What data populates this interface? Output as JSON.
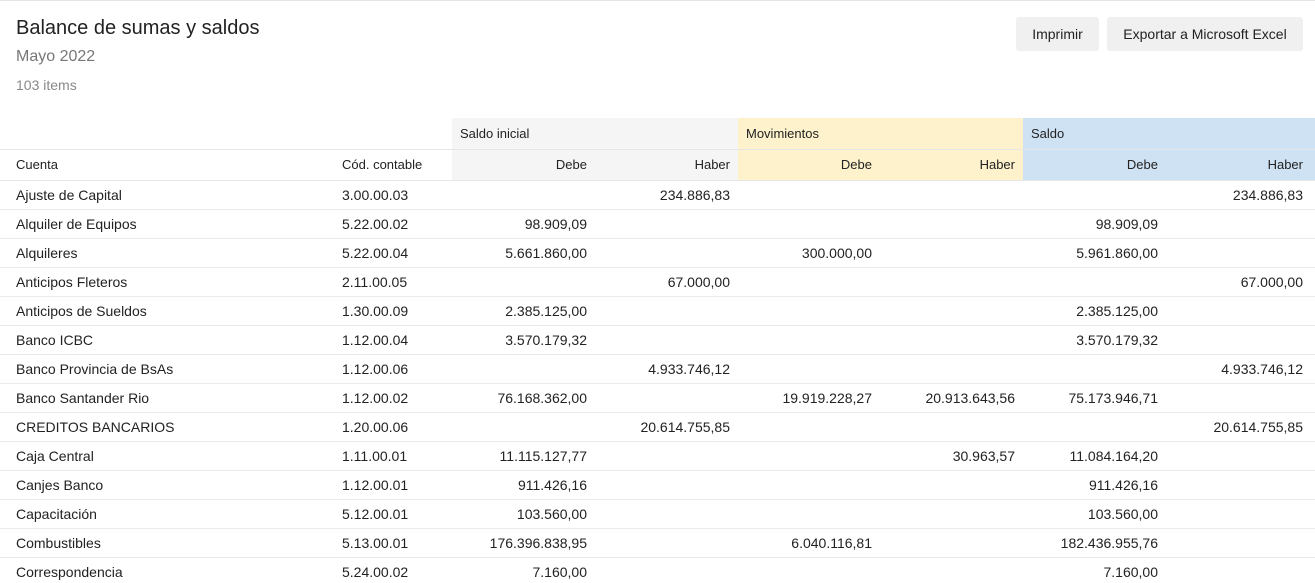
{
  "header": {
    "title": "Balance de sumas y saldos",
    "subtitle": "Mayo 2022",
    "count": "103 items"
  },
  "toolbar": {
    "print_label": "Imprimir",
    "excel_label": "Exportar a Microsoft Excel"
  },
  "table": {
    "groups": {
      "initial": "Saldo inicial",
      "movements": "Movimientos",
      "balance": "Saldo"
    },
    "columns": {
      "account": "Cuenta",
      "code": "Cód. contable",
      "debit": "Debe",
      "credit": "Haber"
    },
    "colors": {
      "initial_bg": "#f5f5f5",
      "movements_bg": "#fdf2cc",
      "balance_bg": "#cfe2f4"
    },
    "rows": [
      {
        "cuenta": "Ajuste de Capital",
        "codigo": "3.00.00.03",
        "si_debe": "",
        "si_haber": "234.886,83",
        "mov_debe": "",
        "mov_haber": "",
        "saldo_debe": "",
        "saldo_haber": "234.886,83"
      },
      {
        "cuenta": "Alquiler de Equipos",
        "codigo": "5.22.00.02",
        "si_debe": "98.909,09",
        "si_haber": "",
        "mov_debe": "",
        "mov_haber": "",
        "saldo_debe": "98.909,09",
        "saldo_haber": ""
      },
      {
        "cuenta": "Alquileres",
        "codigo": "5.22.00.04",
        "si_debe": "5.661.860,00",
        "si_haber": "",
        "mov_debe": "300.000,00",
        "mov_haber": "",
        "saldo_debe": "5.961.860,00",
        "saldo_haber": ""
      },
      {
        "cuenta": "Anticipos Fleteros",
        "codigo": "2.11.00.05",
        "si_debe": "",
        "si_haber": "67.000,00",
        "mov_debe": "",
        "mov_haber": "",
        "saldo_debe": "",
        "saldo_haber": "67.000,00"
      },
      {
        "cuenta": "Anticipos de Sueldos",
        "codigo": "1.30.00.09",
        "si_debe": "2.385.125,00",
        "si_haber": "",
        "mov_debe": "",
        "mov_haber": "",
        "saldo_debe": "2.385.125,00",
        "saldo_haber": ""
      },
      {
        "cuenta": "Banco ICBC",
        "codigo": "1.12.00.04",
        "si_debe": "3.570.179,32",
        "si_haber": "",
        "mov_debe": "",
        "mov_haber": "",
        "saldo_debe": "3.570.179,32",
        "saldo_haber": ""
      },
      {
        "cuenta": "Banco Provincia de BsAs",
        "codigo": "1.12.00.06",
        "si_debe": "",
        "si_haber": "4.933.746,12",
        "mov_debe": "",
        "mov_haber": "",
        "saldo_debe": "",
        "saldo_haber": "4.933.746,12"
      },
      {
        "cuenta": "Banco Santander Rio",
        "codigo": "1.12.00.02",
        "si_debe": "76.168.362,00",
        "si_haber": "",
        "mov_debe": "19.919.228,27",
        "mov_haber": "20.913.643,56",
        "saldo_debe": "75.173.946,71",
        "saldo_haber": ""
      },
      {
        "cuenta": "CREDITOS BANCARIOS",
        "codigo": "1.20.00.06",
        "si_debe": "",
        "si_haber": "20.614.755,85",
        "mov_debe": "",
        "mov_haber": "",
        "saldo_debe": "",
        "saldo_haber": "20.614.755,85"
      },
      {
        "cuenta": "Caja Central",
        "codigo": "1.11.00.01",
        "si_debe": "11.115.127,77",
        "si_haber": "",
        "mov_debe": "",
        "mov_haber": "30.963,57",
        "saldo_debe": "11.084.164,20",
        "saldo_haber": ""
      },
      {
        "cuenta": "Canjes Banco",
        "codigo": "1.12.00.01",
        "si_debe": "911.426,16",
        "si_haber": "",
        "mov_debe": "",
        "mov_haber": "",
        "saldo_debe": "911.426,16",
        "saldo_haber": ""
      },
      {
        "cuenta": "Capacitación",
        "codigo": "5.12.00.01",
        "si_debe": "103.560,00",
        "si_haber": "",
        "mov_debe": "",
        "mov_haber": "",
        "saldo_debe": "103.560,00",
        "saldo_haber": ""
      },
      {
        "cuenta": "Combustibles",
        "codigo": "5.13.00.01",
        "si_debe": "176.396.838,95",
        "si_haber": "",
        "mov_debe": "6.040.116,81",
        "mov_haber": "",
        "saldo_debe": "182.436.955,76",
        "saldo_haber": ""
      },
      {
        "cuenta": "Correspondencia",
        "codigo": "5.24.00.02",
        "si_debe": "7.160,00",
        "si_haber": "",
        "mov_debe": "",
        "mov_haber": "",
        "saldo_debe": "7.160,00",
        "saldo_haber": ""
      }
    ]
  }
}
